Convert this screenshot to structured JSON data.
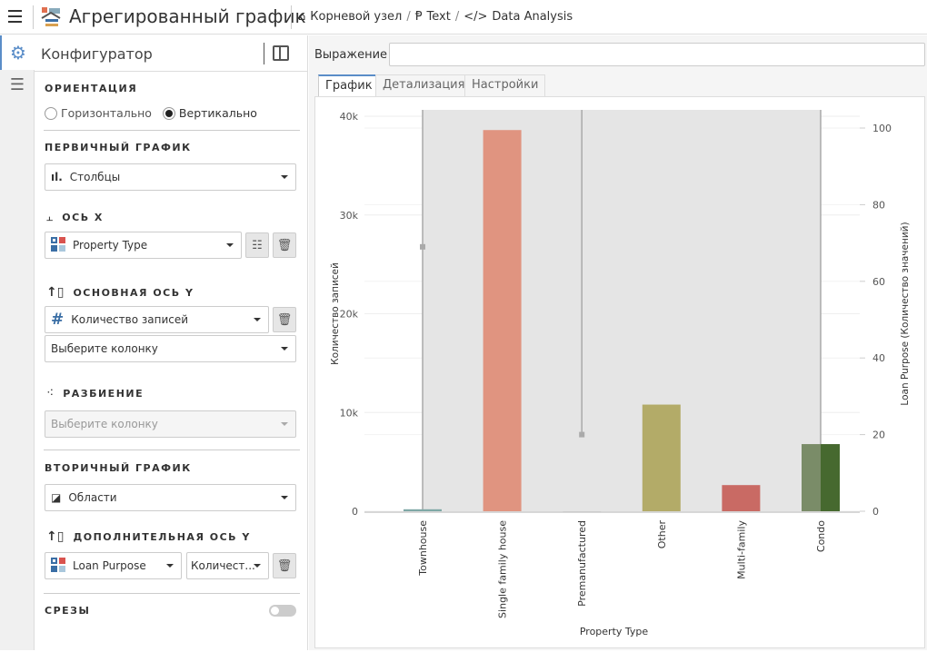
{
  "header": {
    "title": "Агрегированный график",
    "breadcrumb": [
      "Корневой узел",
      "Text",
      "Data Analysis"
    ],
    "separator": "/"
  },
  "rail": {
    "items": [
      {
        "icon": "gear-icon"
      },
      {
        "icon": "sliders-icon"
      }
    ]
  },
  "panel": {
    "title": "Конфигуратор",
    "orientation": {
      "label": "ОРИЕНТАЦИЯ",
      "options": [
        "Горизонтально",
        "Вертикально"
      ],
      "selected": "Вертикально"
    },
    "primary": {
      "label": "ПЕРВИЧНЫЙ ГРАФИК",
      "value": "Столбцы"
    },
    "x_axis": {
      "label": "ОСЬ X",
      "value": "Property Type"
    },
    "y_axis": {
      "label": "ОСНОВНАЯ ОСЬ Y",
      "value": "Количество записей",
      "aggregate_placeholder": "Выберите колонку"
    },
    "split": {
      "label": "РАЗБИЕНИЕ",
      "placeholder": "Выберите колонку"
    },
    "secondary": {
      "label": "ВТОРИЧНЫЙ ГРАФИК",
      "value": "Области"
    },
    "y2_axis": {
      "label": "ДОПОЛНИТЕЛЬНАЯ ОСЬ Y",
      "value": "Loan Purpose",
      "aggregate": "Количест..."
    },
    "slices": {
      "label": "СРЕЗЫ",
      "enabled": false
    }
  },
  "main": {
    "expression_label": "Выражение",
    "expression_value": "",
    "tabs": [
      "График",
      "Детализация",
      "Настройки"
    ],
    "active_tab": "График"
  },
  "chart_data": {
    "type": "bar",
    "categories": [
      "Townhouse",
      "Single family house",
      "Premanufactured",
      "Other",
      "Multi-family",
      "Condo"
    ],
    "series": [
      {
        "values": [
          200,
          38600,
          0,
          10800,
          2650,
          6800
        ],
        "colors": [
          "#7fa8a6",
          "#e09480",
          "#cccccc",
          "#b3ab68",
          "#c96a64",
          "#7a8c68"
        ]
      },
      {
        "type": "area",
        "values": [
          69,
          null,
          20,
          null,
          null,
          17.5
        ],
        "color": "#cfcfcf"
      }
    ],
    "xlabel": "Property Type",
    "ylabel": "Количество записей",
    "y2label": "Loan Purpose (Количество значений)",
    "ylim": [
      0,
      40000
    ],
    "yticks": [
      "0",
      "10k",
      "20k",
      "30k",
      "40k"
    ],
    "ytick_values": [
      0,
      10000,
      20000,
      30000,
      40000
    ],
    "y2lim": [
      0,
      100
    ],
    "y2ticks": [
      "0",
      "20",
      "40",
      "60",
      "80",
      "100"
    ],
    "grid": true,
    "accent": "#5a8dc8"
  }
}
